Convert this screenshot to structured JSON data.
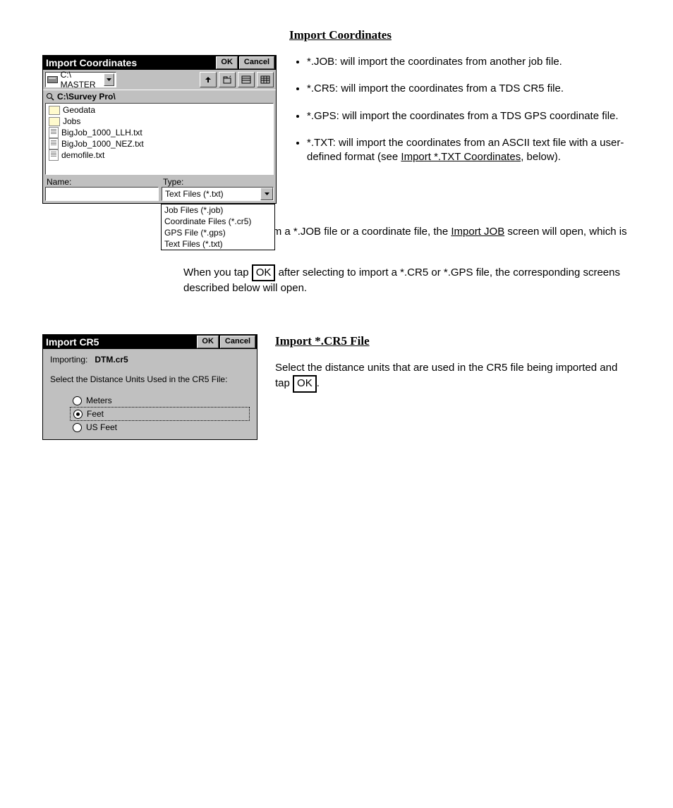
{
  "import_coords": {
    "title": "Import Coordinates",
    "ok": "OK",
    "cancel": "Cancel",
    "drive": "C:\\ MASTER",
    "path": "C:\\Survey Pro\\",
    "files": [
      {
        "name": "Geodata",
        "type": "folder"
      },
      {
        "name": "Jobs",
        "type": "folder"
      },
      {
        "name": "BigJob_1000_LLH.txt",
        "type": "file"
      },
      {
        "name": "BigJob_1000_NEZ.txt",
        "type": "file"
      },
      {
        "name": "demofile.txt",
        "type": "file"
      }
    ],
    "name_label": "Name:",
    "name_value": "",
    "type_label": "Type:",
    "type_selected": "Text Files (*.txt)",
    "type_options": [
      "Job Files (*.job)",
      "Coordinate Files (*.cr5)",
      "GPS File (*.gps)",
      "Text Files (*.txt)"
    ]
  },
  "section1": {
    "heading": "Import Coordinates",
    "bullets": [
      "*.JOB: will import the coordinates from another job file. ",
      "*.CR5: will import the coordinates from a TDS CR5 file. ",
      "*.GPS: will import the coordinates from a TDS GPS coordinate file. ",
      "*.TXT: will import the coordinates from an ASCII text file with a user-defined format (see ",
      "Import *.TXT Coordinates",
      ", below)."
    ],
    "para1a": "When importing from a *.JOB file or a coordinate file, the ",
    "para1b": "Import JOB",
    "para1c": " screen will open, which is described below.",
    "para2a": "When you tap ",
    "para2b": " after selecting to import a *.CR5 or *.GPS file, the corresponding screens described below will open."
  },
  "ok_btn": "OK",
  "section2": {
    "heading": "Import *.CR5 File",
    "para_a": "Select the distance units that are used in the CR5 file being imported and tap ",
    "para_b": "."
  },
  "import_cr5": {
    "title": "Import CR5",
    "ok": "OK",
    "cancel": "Cancel",
    "importing_label": "Importing:",
    "importing_file": "DTM.cr5",
    "prompt": "Select the Distance Units Used in the CR5 File:",
    "options": [
      "Meters",
      "Feet",
      "US Feet"
    ],
    "selected": "Feet"
  }
}
